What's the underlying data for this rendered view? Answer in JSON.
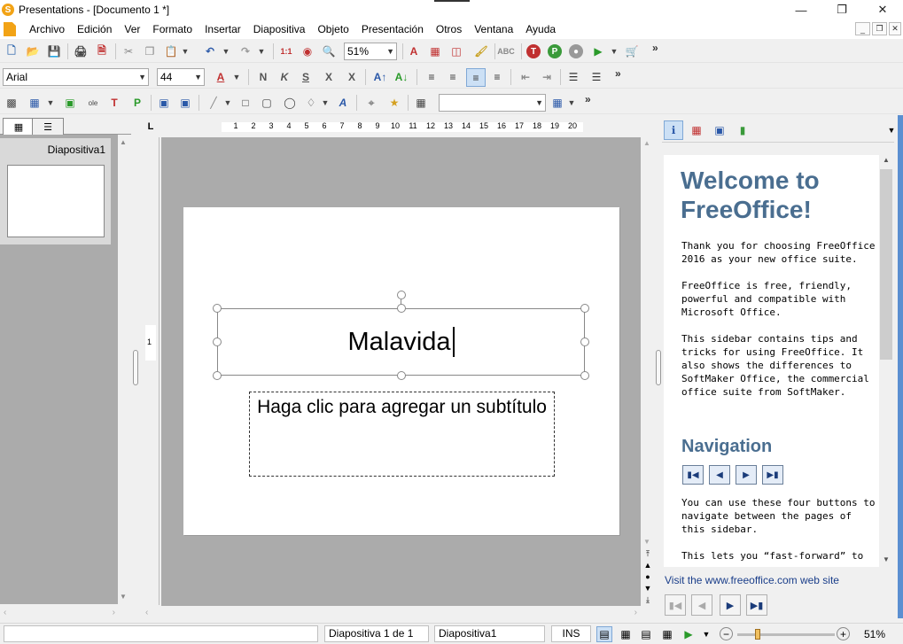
{
  "window": {
    "title": "Presentations - [Documento 1 *]",
    "app_letter": "S"
  },
  "menu": [
    "Archivo",
    "Edición",
    "Ver",
    "Formato",
    "Insertar",
    "Diapositiva",
    "Objeto",
    "Presentación",
    "Otros",
    "Ventana",
    "Ayuda"
  ],
  "toolbar": {
    "zoom": "51%"
  },
  "format": {
    "font": "Arial",
    "size": "44"
  },
  "slides_panel": {
    "slide_label": "Diapositiva1"
  },
  "ruler": {
    "marks": [
      "1",
      "2",
      "3",
      "4",
      "5",
      "6",
      "7",
      "8",
      "9",
      "10",
      "11",
      "12",
      "13",
      "14",
      "15",
      "16",
      "17",
      "18",
      "19",
      "20"
    ],
    "vertical_mark": "1"
  },
  "slide": {
    "title": "Malavida",
    "subtitle": "Haga clic para agregar un subtítulo"
  },
  "sidebar": {
    "heading": "Welcome to FreeOffice!",
    "para1": "Thank you for choosing FreeOffice 2016 as your new office suite.",
    "para2": "FreeOffice is free, friendly, powerful and compatible with Microsoft Office.",
    "para3": "This sidebar contains tips and tricks for using FreeOffice. It also shows the differences to SoftMaker Office, the commercial office suite from SoftMaker.",
    "nav_heading": "Navigation",
    "para4": "You can use these four buttons to navigate between the pages of this sidebar.",
    "para5": "This lets you “fast-forward” to",
    "link": "Visit the www.freeoffice.com web site"
  },
  "status": {
    "slide_info": "Diapositiva 1 de 1",
    "slide_name": "Diapositiva1",
    "mode": "INS",
    "zoom": "51%"
  },
  "colors": {
    "accent": "#5b8fd1",
    "heading": "#4a6e90",
    "canvas": "#ababab"
  }
}
